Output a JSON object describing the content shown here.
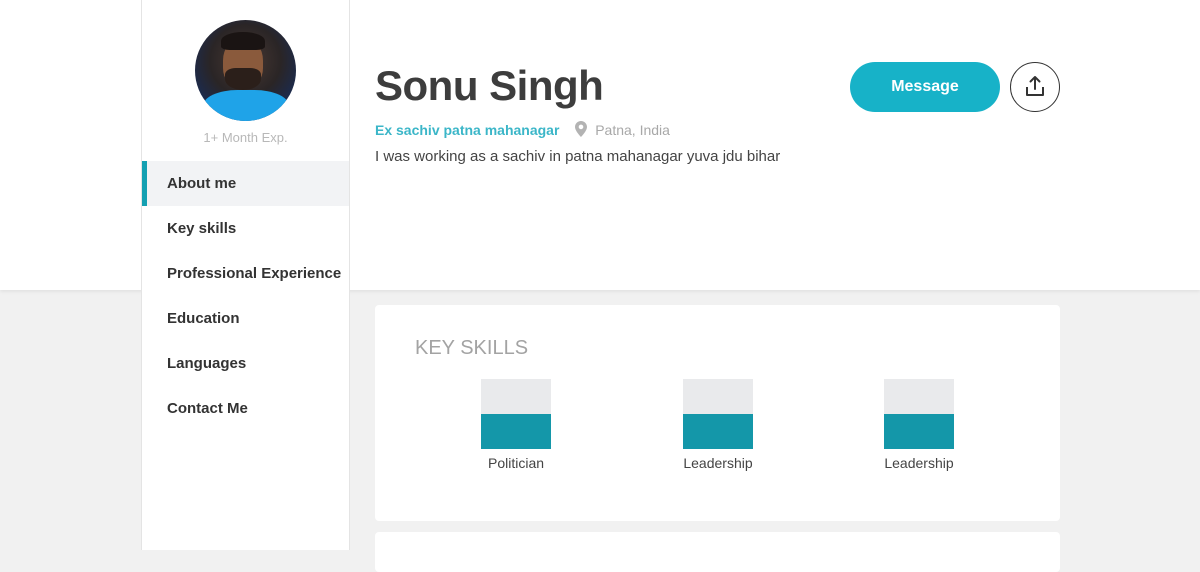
{
  "profile": {
    "name": "Sonu Singh",
    "experience": "1+ Month Exp.",
    "title": "Ex sachiv patna mahanagar",
    "location": "Patna, India",
    "bio": "I was working as a sachiv in patna mahanagar yuva jdu bihar"
  },
  "actions": {
    "message_label": "Message",
    "share_icon": "share-upload-icon"
  },
  "nav": {
    "items": [
      {
        "label": "About me",
        "active": true
      },
      {
        "label": "Key skills",
        "active": false
      },
      {
        "label": "Professional Experience",
        "active": false
      },
      {
        "label": "Education",
        "active": false
      },
      {
        "label": "Languages",
        "active": false
      },
      {
        "label": "Contact Me",
        "active": false
      }
    ]
  },
  "key_skills": {
    "heading": "KEY SKILLS",
    "skills": [
      {
        "name": "Politician",
        "level": 0.5
      },
      {
        "name": "Leadership",
        "level": 0.5
      },
      {
        "name": "Leadership",
        "level": 0.5
      }
    ]
  },
  "colors": {
    "accent": "#17b2c8",
    "skill_fill": "#1497a9",
    "skill_track": "#e9eaec",
    "title_link": "#3bb6c8"
  }
}
